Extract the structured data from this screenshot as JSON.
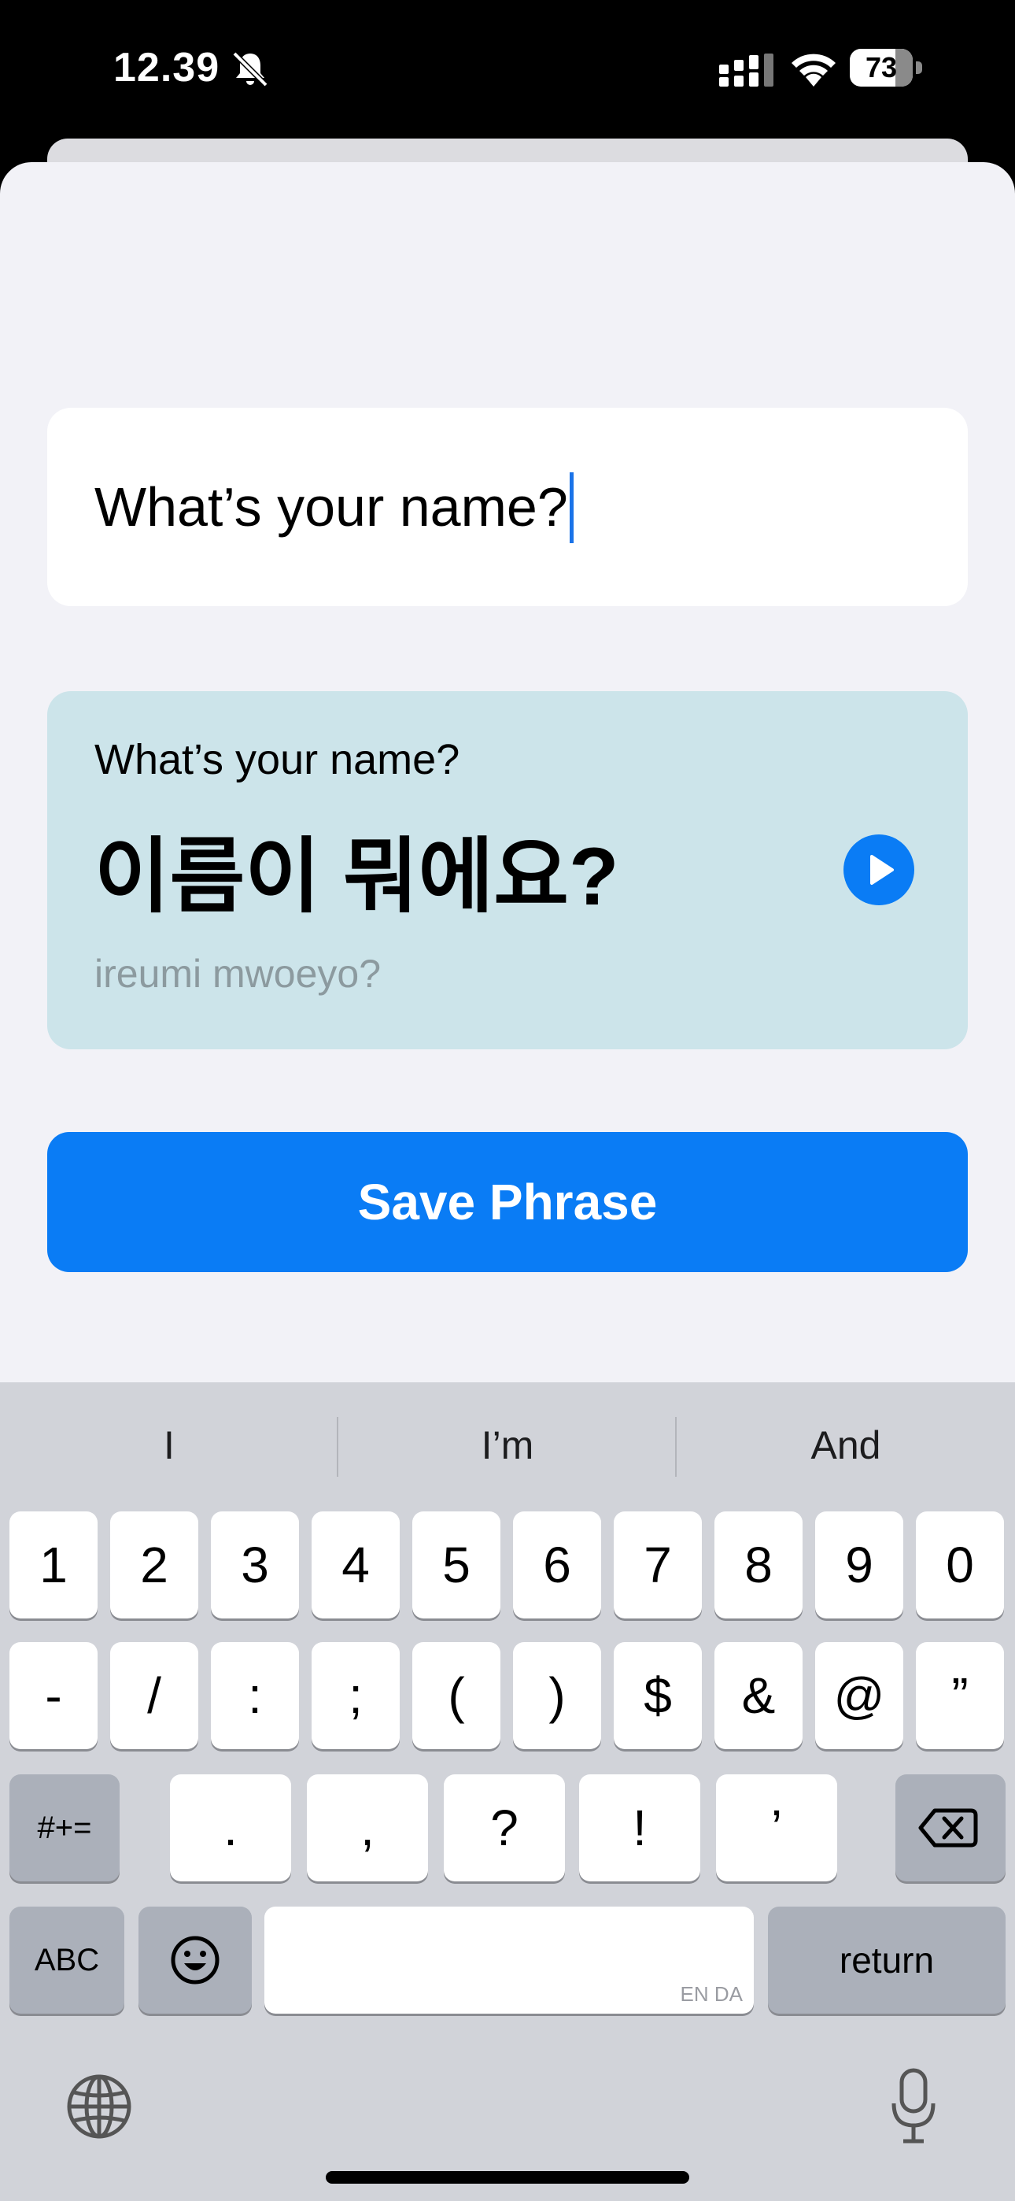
{
  "status_bar": {
    "time": "12.39",
    "battery": "73"
  },
  "input": {
    "value": "What’s your name?"
  },
  "translation": {
    "source": "What’s your name?",
    "target": "이름이 뭐에요?",
    "romanization": "ireumi mwoeyo?"
  },
  "save_button": {
    "label": "Save Phrase"
  },
  "keyboard": {
    "suggestions": [
      "I",
      "I’m",
      "And"
    ],
    "row1": [
      "1",
      "2",
      "3",
      "4",
      "5",
      "6",
      "7",
      "8",
      "9",
      "0"
    ],
    "row2": [
      "-",
      "/",
      ":",
      ";",
      "(",
      ")",
      "$",
      "&",
      "@",
      "”"
    ],
    "row3": {
      "mode": "#+=",
      "keys": [
        ".",
        ",",
        "?",
        "!",
        "’"
      ]
    },
    "abc": "ABC",
    "space_lang": "EN DA",
    "return": "return"
  },
  "icons": [
    "bell-slash-icon",
    "cellular-signal-icon",
    "wifi-icon",
    "battery-icon",
    "play-icon",
    "delete-icon",
    "emoji-icon",
    "globe-icon",
    "microphone-icon"
  ],
  "colors": {
    "accent": "#0A7CF5",
    "translation_card": "#CCE4EA",
    "sheet": "#F2F2F7",
    "keyboard": "#D1D3D9"
  }
}
